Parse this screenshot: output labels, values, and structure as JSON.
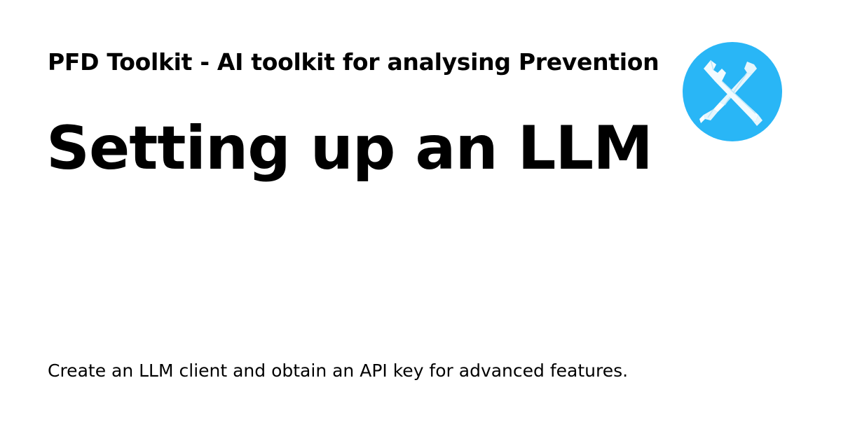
{
  "header": {
    "site_title": "PFD Toolkit - AI toolkit for analysing Prevention"
  },
  "main": {
    "page_title": "Setting up an LLM",
    "description": "Create an LLM client and obtain an API key for advanced features."
  },
  "logo": {
    "icon": "wrench-screwdriver-icon",
    "color": "#29b6f6"
  },
  "colors": {
    "background": "#ffffff",
    "text": "#000000",
    "accent": "#29b6f6"
  }
}
